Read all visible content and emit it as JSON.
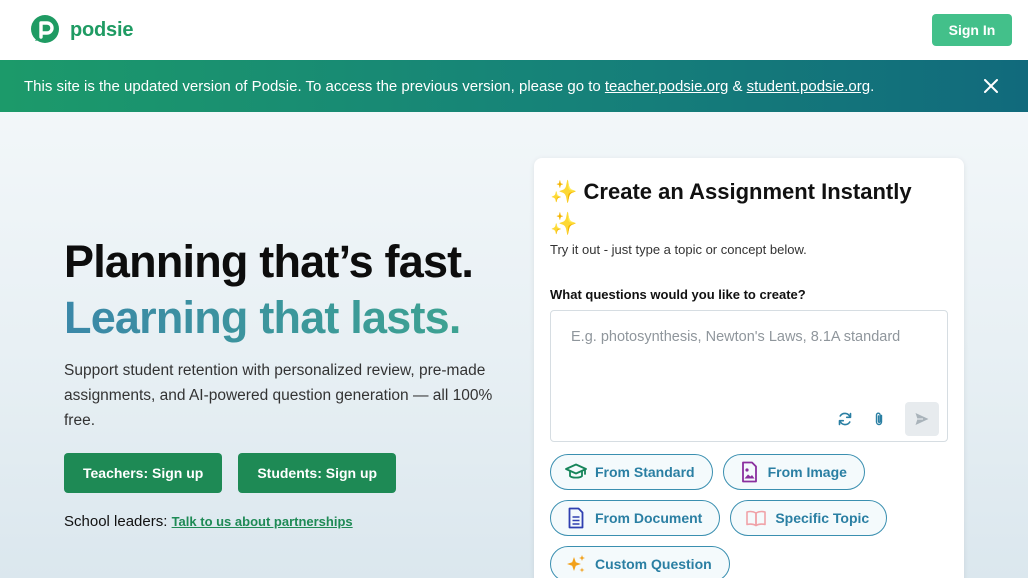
{
  "header": {
    "logo_text": "podsie",
    "signin_label": "Sign In"
  },
  "banner": {
    "text_before": "This site is the updated version of Podsie. To access the previous version, please go to ",
    "link1": "teacher.podsie.org",
    "between": " & ",
    "link2": "student.podsie.org",
    "text_after": "."
  },
  "hero": {
    "headline1": "Planning that’s fast.",
    "headline2": "Learning that lasts.",
    "description": "Support student retention with personalized review, pre-made assignments, and AI-powered question generation — all 100% free.",
    "teachers_cta": "Teachers: Sign up",
    "students_cta": "Students: Sign up",
    "leaders_label": "School leaders: ",
    "leaders_link": "Talk to us about partnerships"
  },
  "card": {
    "sparkle": "✨",
    "title": "Create an Assignment Instantly",
    "subtitle": "Try it out - just type a topic or concept below.",
    "question_label": "What questions would you like to create?",
    "input_placeholder": "E.g. photosynthesis, Newton's Laws, 8.1A standard",
    "input_value": "",
    "chips": [
      {
        "label": "From Standard",
        "icon": "graduation-cap-icon"
      },
      {
        "label": "From Image",
        "icon": "image-file-icon"
      },
      {
        "label": "From Document",
        "icon": "document-icon"
      },
      {
        "label": "Specific Topic",
        "icon": "open-book-icon"
      },
      {
        "label": "Custom Question",
        "icon": "sparkles-icon"
      }
    ]
  },
  "colors": {
    "brand_green": "#1f9b63",
    "signin_green": "#43c08a",
    "cta_green": "#1e8a55",
    "chip_blue": "#2a7fa3"
  }
}
